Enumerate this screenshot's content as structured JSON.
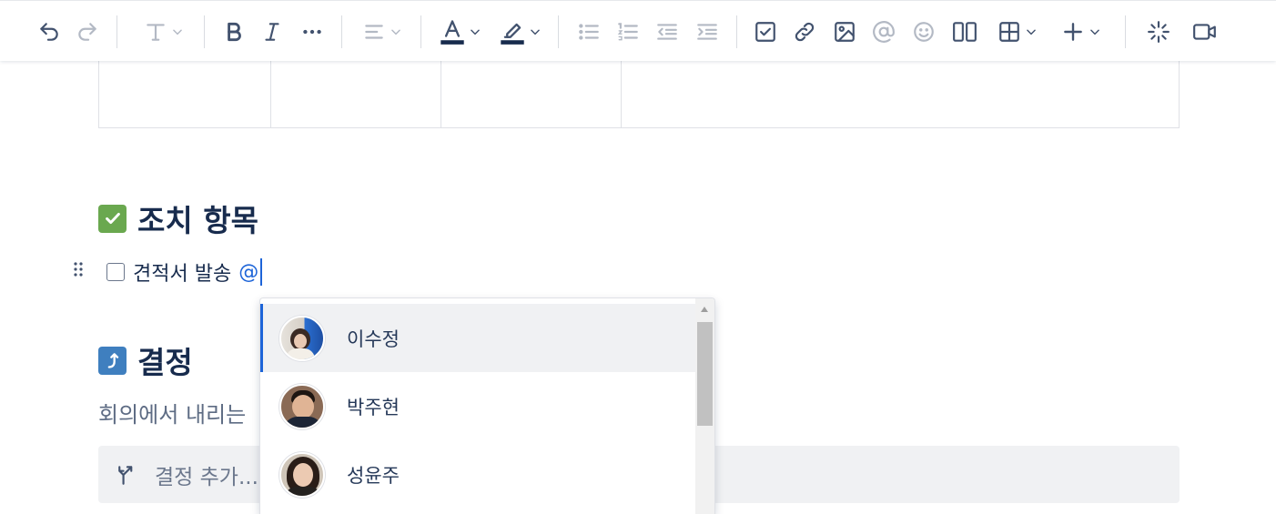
{
  "toolbar": {
    "icons": [
      "undo-icon",
      "redo-icon",
      "text-style-icon",
      "bold-icon",
      "italic-icon",
      "more-formatting-icon",
      "align-icon",
      "text-color-icon",
      "highlight-icon",
      "bullet-list-icon",
      "numbered-list-icon",
      "outdent-icon",
      "indent-icon",
      "task-icon",
      "link-icon",
      "image-icon",
      "mention-icon",
      "emoji-icon",
      "layout-icon",
      "table-icon",
      "insert-icon",
      "ai-icon",
      "video-icon"
    ],
    "text_color": "#172b4d",
    "highlight_color": "#172b4d"
  },
  "document": {
    "action_items": {
      "emoji": "check-mark-button-icon",
      "heading": "조치 항목"
    },
    "task": {
      "text": "견적서 발송",
      "mention_trigger": "@"
    },
    "decisions": {
      "emoji": "up-arrow-icon",
      "heading": "결정",
      "help_text": "회의에서 내리는",
      "placeholder": "결정 추가..."
    }
  },
  "mention_popup": {
    "users": [
      {
        "name": "이수정",
        "selected": true
      },
      {
        "name": "박주현",
        "selected": false
      },
      {
        "name": "성윤주",
        "selected": false
      }
    ]
  },
  "colors": {
    "accent": "#1d64d8",
    "check_emoji": "#6aa84f",
    "arrow_emoji": "#3f7fbf"
  }
}
